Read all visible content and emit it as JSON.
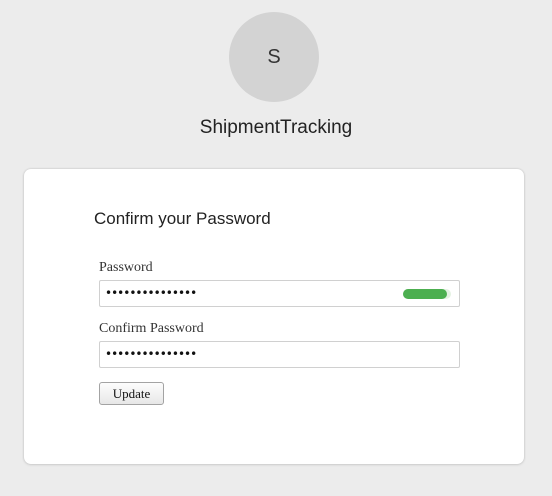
{
  "avatar": {
    "initial": "S"
  },
  "app": {
    "name": "ShipmentTracking"
  },
  "form": {
    "title": "Confirm your Password",
    "password": {
      "label": "Password",
      "masked_value": "•••••••••••••••",
      "strength_fraction": 0.92,
      "strength_color": "#4caf50"
    },
    "confirm_password": {
      "label": "Confirm Password",
      "masked_value": "•••••••••••••••"
    },
    "update_label": "Update"
  }
}
